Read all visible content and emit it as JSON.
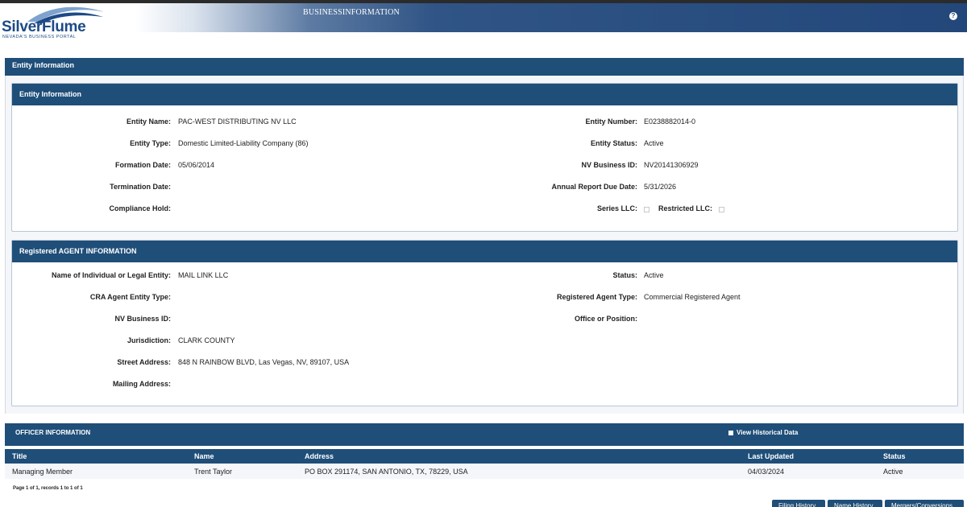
{
  "header": {
    "logo_text": "SilverFlume",
    "logo_subtitle": "NEVADA'S BUSINESS PORTAL",
    "title": "BUSINESSINFORMATION",
    "help_glyph": "?"
  },
  "outer_section": {
    "title": "Entity Information"
  },
  "entity_panel": {
    "title": "Entity Information",
    "left": [
      {
        "label": "Entity Name:",
        "value": "PAC-WEST DISTRIBUTING NV LLC"
      },
      {
        "label": "Entity Type:",
        "value": "Domestic Limited-Liability Company (86)"
      },
      {
        "label": "Formation Date:",
        "value": "05/06/2014"
      },
      {
        "label": "Termination Date:",
        "value": ""
      },
      {
        "label": "Compliance Hold:",
        "value": ""
      }
    ],
    "right": [
      {
        "label": "Entity Number:",
        "value": "E0238882014-0"
      },
      {
        "label": "Entity Status:",
        "value": "Active"
      },
      {
        "label": "NV Business ID:",
        "value": "NV20141306929"
      },
      {
        "label": "Annual Report Due Date:",
        "value": "5/31/2026"
      }
    ],
    "series_llc_label": "Series LLC:",
    "restricted_llc_label": "Restricted LLC:"
  },
  "agent_panel": {
    "title": "Registered AGENT INFORMATION",
    "left": [
      {
        "label": "Name of Individual or Legal Entity:",
        "value": "MAIL LINK LLC"
      },
      {
        "label": "CRA Agent Entity Type:",
        "value": ""
      },
      {
        "label": "NV Business ID:",
        "value": ""
      },
      {
        "label": "Jurisdiction:",
        "value": "CLARK COUNTY"
      },
      {
        "label": "Street Address:",
        "value": "848 N RAINBOW BLVD, Las Vegas, NV, 89107, USA"
      },
      {
        "label": "Mailing Address:",
        "value": ""
      }
    ],
    "right": [
      {
        "label": "Status:",
        "value": "Active"
      },
      {
        "label": "Registered Agent Type:",
        "value": "Commercial Registered Agent"
      },
      {
        "label": "Office or Position:",
        "value": ""
      }
    ]
  },
  "officers": {
    "title": "OFFICER INFORMATION",
    "historical_label": "View Historical Data",
    "columns": [
      "Title",
      "Name",
      "Address",
      "Last Updated",
      "Status"
    ],
    "rows": [
      [
        "Managing Member",
        "Trent Taylor",
        "PO BOX 291174, SAN ANTONIO, TX, 78229, USA",
        "04/03/2024",
        "Active"
      ]
    ],
    "pager": "Page 1 of 1, records 1 to 1 of 1"
  },
  "buttons": {
    "filing_history": "Filing History",
    "name_history": "Name History",
    "mergers": "Mergers/Conversions"
  },
  "colors": {
    "navy": "#1f4e79",
    "brand": "#1d4a86"
  }
}
